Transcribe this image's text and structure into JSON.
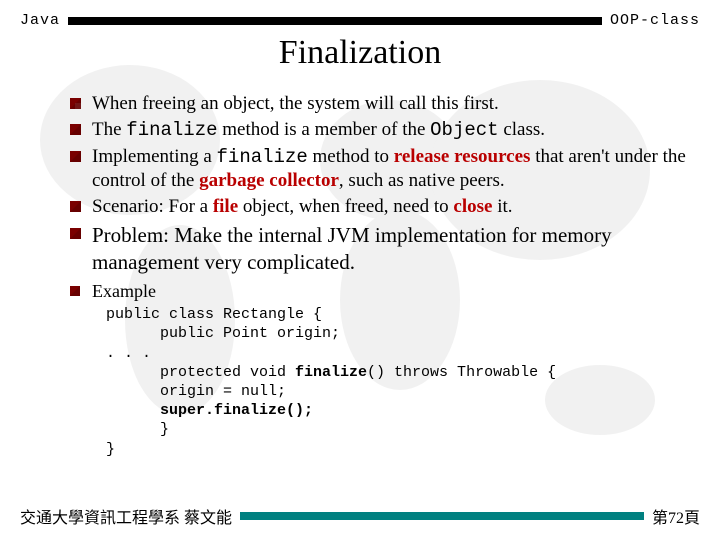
{
  "header": {
    "left": "Java",
    "right": "OOP-class"
  },
  "title": "Finalization",
  "bullets": {
    "b1": "When freeing an object, the system will call this first.",
    "b2a": "The ",
    "b2b": "finalize",
    "b2c": " method is a member of the ",
    "b2d": "Object",
    "b2e": " class.",
    "b3a": "Implementing a ",
    "b3b": "finalize",
    "b3c": " method to ",
    "b3d": "release resources",
    "b3e": " that aren't under the control of the ",
    "b3f": "garbage collector",
    "b3g": ", such as native peers.",
    "b4a": "Scenario: For a ",
    "b4b": "file",
    "b4c": " object, when freed, need to ",
    "b4d": "close",
    "b4e": " it.",
    "b5": "Problem: Make the internal JVM implementation for memory management very complicated.",
    "b6": "Example"
  },
  "code": {
    "l1": "public class Rectangle {",
    "l2": "      public Point origin;",
    "l3": ". . .",
    "l4a": "      protected void ",
    "l4b": "finalize",
    "l4c": "() throws Throwable {",
    "l5": "      origin = null;",
    "l6a": "      ",
    "l6b": "super.finalize();",
    "l7": "      }",
    "l8": "}"
  },
  "footer": {
    "left": "交通大學資訊工程學系 蔡文能",
    "right": "第72頁"
  }
}
